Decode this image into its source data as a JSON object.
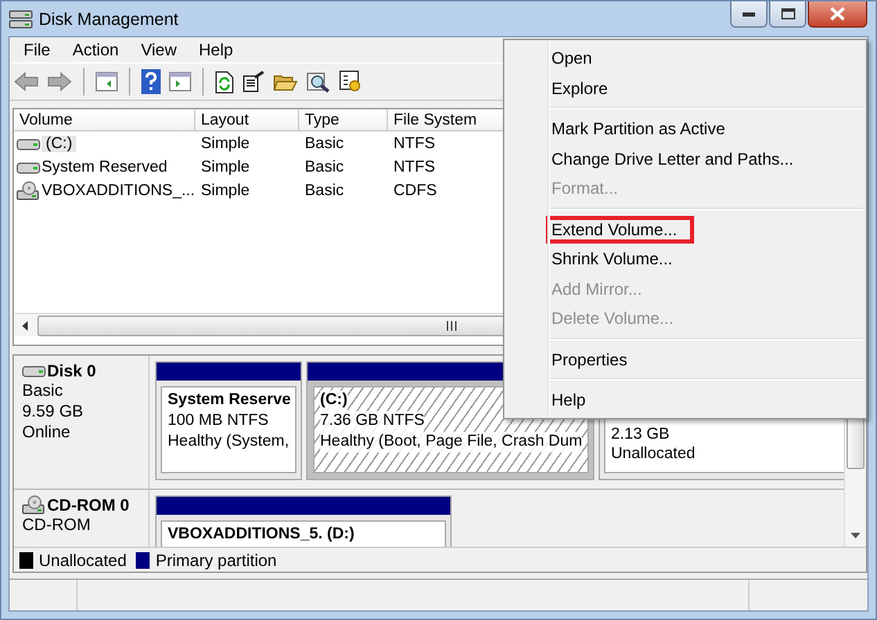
{
  "window": {
    "title": "Disk Management"
  },
  "menu_bar": [
    "File",
    "Action",
    "View",
    "Help"
  ],
  "volumes": {
    "columns": [
      "Volume",
      "Layout",
      "Type",
      "File System"
    ],
    "rows": [
      {
        "kind": "disk",
        "selected": true,
        "cells": [
          "(C:)",
          "Simple",
          "Basic",
          "NTFS"
        ]
      },
      {
        "kind": "disk",
        "selected": false,
        "cells": [
          "System Reserved",
          "Simple",
          "Basic",
          "NTFS"
        ]
      },
      {
        "kind": "cd",
        "selected": false,
        "cells": [
          "VBOXADDITIONS_...",
          "Simple",
          "Basic",
          "CDFS"
        ]
      }
    ]
  },
  "disks": [
    {
      "kind": "disk",
      "name": "Disk 0",
      "lines": [
        "Basic",
        "9.59 GB",
        "Online"
      ],
      "partitions": [
        {
          "kind": "primary",
          "selected": false,
          "title": "System Reserve",
          "lines": [
            "100 MB NTFS",
            "Healthy (System,"
          ]
        },
        {
          "kind": "primary",
          "selected": true,
          "title": "(C:)",
          "lines": [
            "7.36 GB NTFS",
            "Healthy (Boot, Page File, Crash Dum"
          ]
        },
        {
          "selected": false,
          "lines": [
            "2.13 GB",
            "Unallocated"
          ]
        }
      ]
    },
    {
      "kind": "cd",
      "name": "CD-ROM 0",
      "lines": [
        "CD-ROM"
      ],
      "partitions": [
        {
          "kind": "primary",
          "selected": false,
          "title": "VBOXADDITIONS_5. (D:)"
        }
      ]
    }
  ],
  "legend": [
    {
      "label": "Unallocated",
      "color": "#000000"
    },
    {
      "label": "Primary partition",
      "color": "#000080"
    }
  ],
  "context_menu": [
    {
      "kind": "item",
      "label": "Open",
      "disabled": false,
      "highlighted": false
    },
    {
      "kind": "item",
      "label": "Explore",
      "disabled": false,
      "highlighted": false
    },
    {
      "kind": "separator"
    },
    {
      "kind": "item",
      "label": "Mark Partition as Active",
      "disabled": false,
      "highlighted": false
    },
    {
      "kind": "item",
      "label": "Change Drive Letter and Paths...",
      "disabled": false,
      "highlighted": false
    },
    {
      "kind": "item",
      "label": "Format...",
      "disabled": true,
      "highlighted": false
    },
    {
      "kind": "separator"
    },
    {
      "kind": "item",
      "label": "Extend Volume...",
      "disabled": false,
      "highlighted": true
    },
    {
      "kind": "item",
      "label": "Shrink Volume...",
      "disabled": false,
      "highlighted": false
    },
    {
      "kind": "item",
      "label": "Add Mirror...",
      "disabled": true,
      "highlighted": false
    },
    {
      "kind": "item",
      "label": "Delete Volume...",
      "disabled": true,
      "highlighted": false
    },
    {
      "kind": "separator"
    },
    {
      "kind": "item",
      "label": "Properties",
      "disabled": false,
      "highlighted": false
    },
    {
      "kind": "separator"
    },
    {
      "kind": "item",
      "label": "Help",
      "disabled": false,
      "highlighted": false
    }
  ]
}
